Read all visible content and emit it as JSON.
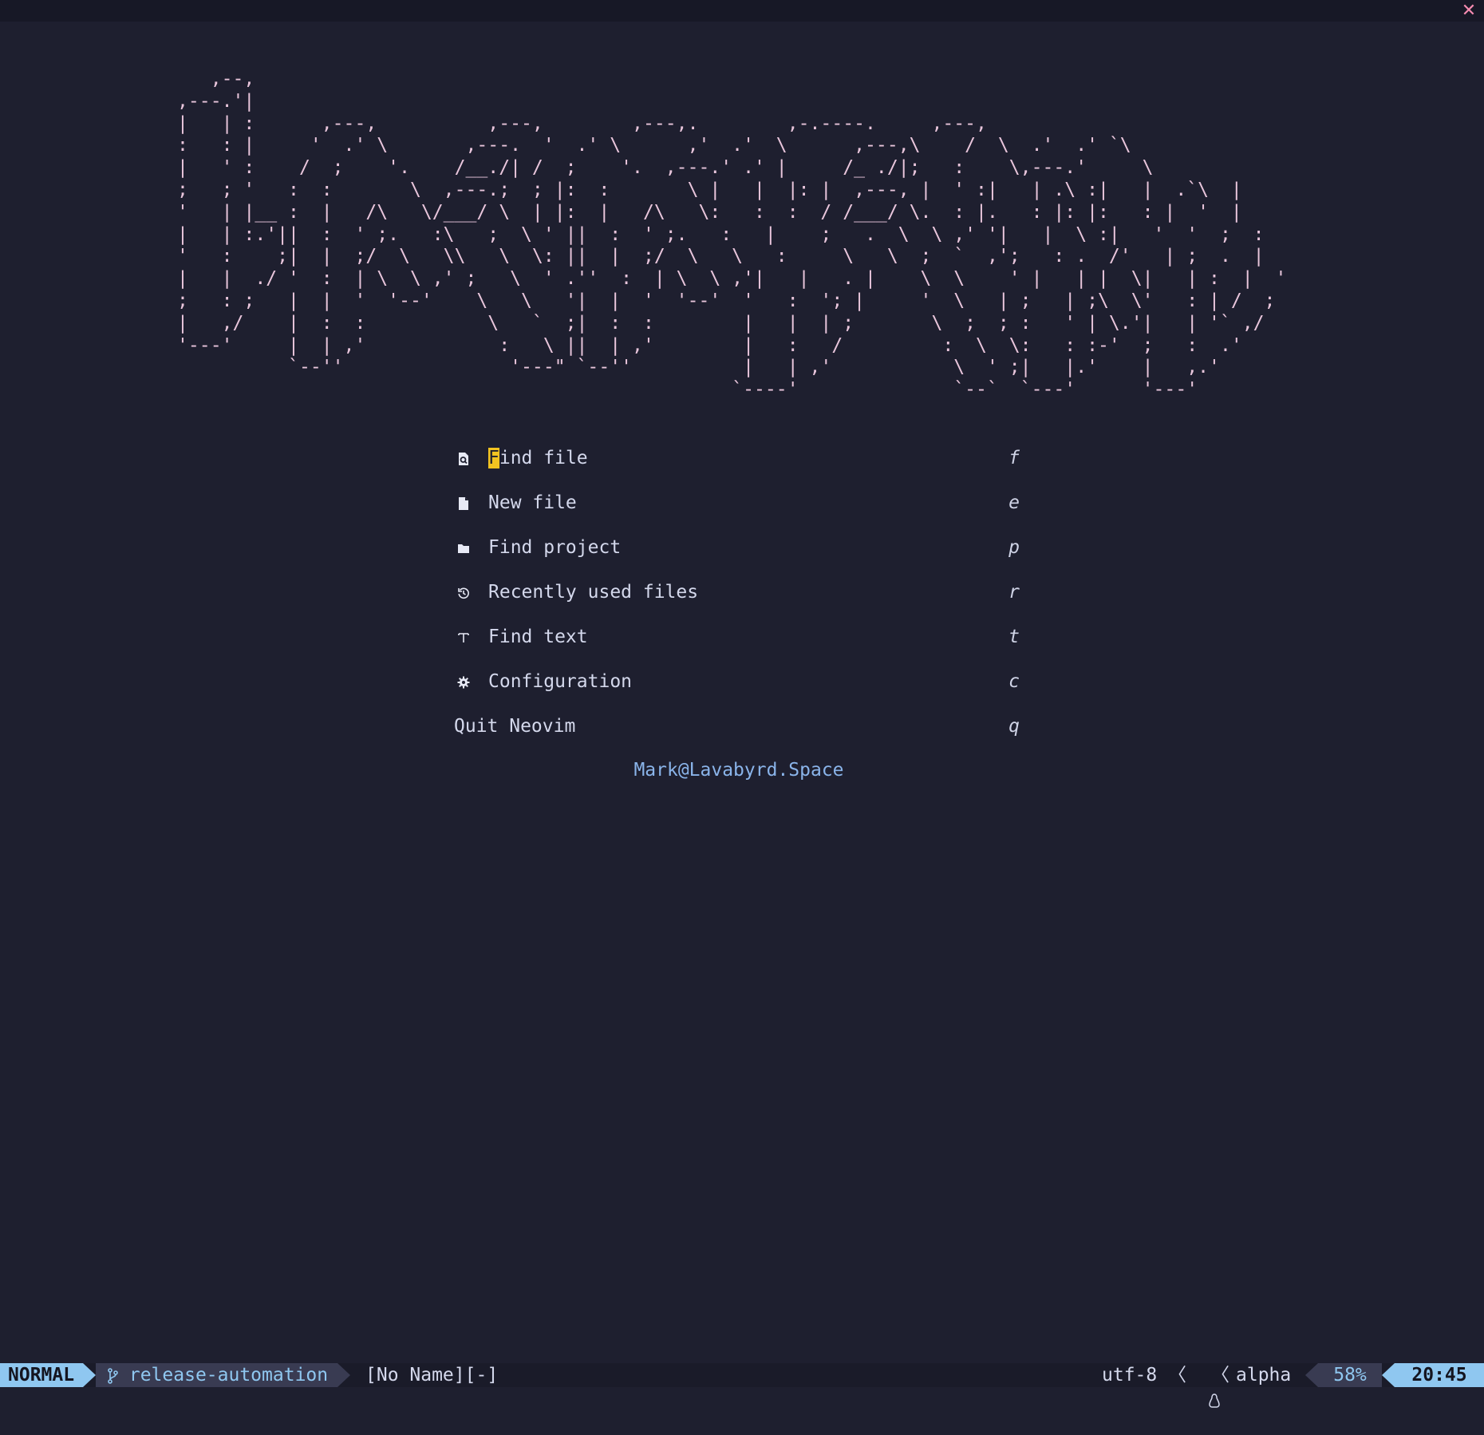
{
  "window": {
    "close_glyph": "✕"
  },
  "banner": [
    "   ,--,",
    ",---.'|",
    "|   | :      ,---,          ,---,        ,---,.        ,-.----.     ,---,",
    ":   : |     '  .' \\       ,---.  '  .' \\      ,'  .'  \\      ,---,\\    /  \\  .'  .' `\\",
    "|   ' :    /  ;    '.    /__./| /  ;    '.  ,---.' .' |     /_ ./|;   :    \\,---.'     \\",
    ";   ; '   :  :       \\  ,---.;  ; |:  :       \\ |   |  |: |  ,---, |  ' :|   | .\\ :|   |  .`\\  |",
    "'   | |__ :  |   /\\   \\/___/ \\  | |:  |   /\\   \\:   :  :  / /___/ \\.  : |.   : |: |:   : |  '  |",
    "|   | :.'||  :  ' ;.   :\\   ;  \\ ' ||  :  ' ;.   :   |    ;   .  \\  \\ ,' '|   |  \\ :|   '  '  ;  :",
    "'   :    ;|  |  ;/  \\   \\\\   \\  \\: ||  |  ;/  \\   \\   :     \\   \\  ;  `  ,';   : .  /'   | ;  .  |",
    "|   |  ./ '  :  | \\  \\ ,' ;   \\  ' .''  :  | \\  \\ ,'|   |   . |    \\  \\    ' |   | |  \\|   | :  |  '",
    ";   : ;   |  |  '  '--'    \\   \\   '|  |  '  '--'  '   :  '; |     '  \\   | ;   | ;\\  \\'   : | /  ;",
    "|   ,/    |  :  :           \\   `  ;|  :  :        |   |  | ;       \\  ;  ; :   ' | \\.'|   | '` ,/",
    "'---'     |  | ,'            :   \\ ||  | ,'        |   :   /         :  \\  \\:   : :-'  ;   :  .'",
    "          `--''               '---\" `--''          |   | ,'           \\  ' ;|   |.'    |   ,.'",
    "                                                  `----'              `--`  `---'      '---'"
  ],
  "menu": [
    {
      "icon": "find-file-icon",
      "label": "Find file",
      "shortcut": "f"
    },
    {
      "icon": "new-file-icon",
      "label": "New file",
      "shortcut": "e"
    },
    {
      "icon": "folder-icon",
      "label": "Find project",
      "shortcut": "p"
    },
    {
      "icon": "history-icon",
      "label": "Recently used files",
      "shortcut": "r"
    },
    {
      "icon": "text-icon",
      "label": "Find text",
      "shortcut": "t"
    },
    {
      "icon": "gear-icon",
      "label": "Configuration",
      "shortcut": "c"
    },
    {
      "icon": "",
      "label": "Quit Neovim",
      "shortcut": "q"
    }
  ],
  "menu_first": {
    "cursor_char": "F",
    "rest": "ind file"
  },
  "footer": "Mark@Lavabyrd.Space",
  "statusline": {
    "mode": "NORMAL",
    "branch_icon": "git-branch-icon",
    "branch": "release-automation",
    "filename": "[No Name][-]",
    "encoding": "utf-8",
    "separator": "〈",
    "os_icon": "linux-icon",
    "filetype": "alpha",
    "percent": "58%",
    "clock": "20:45"
  },
  "colors": {
    "background": "#1e1f2f",
    "banner": "#e9c6dc",
    "accent": "#8fc7f0",
    "cursor": "#f2c321",
    "close": "#f58bb0"
  }
}
